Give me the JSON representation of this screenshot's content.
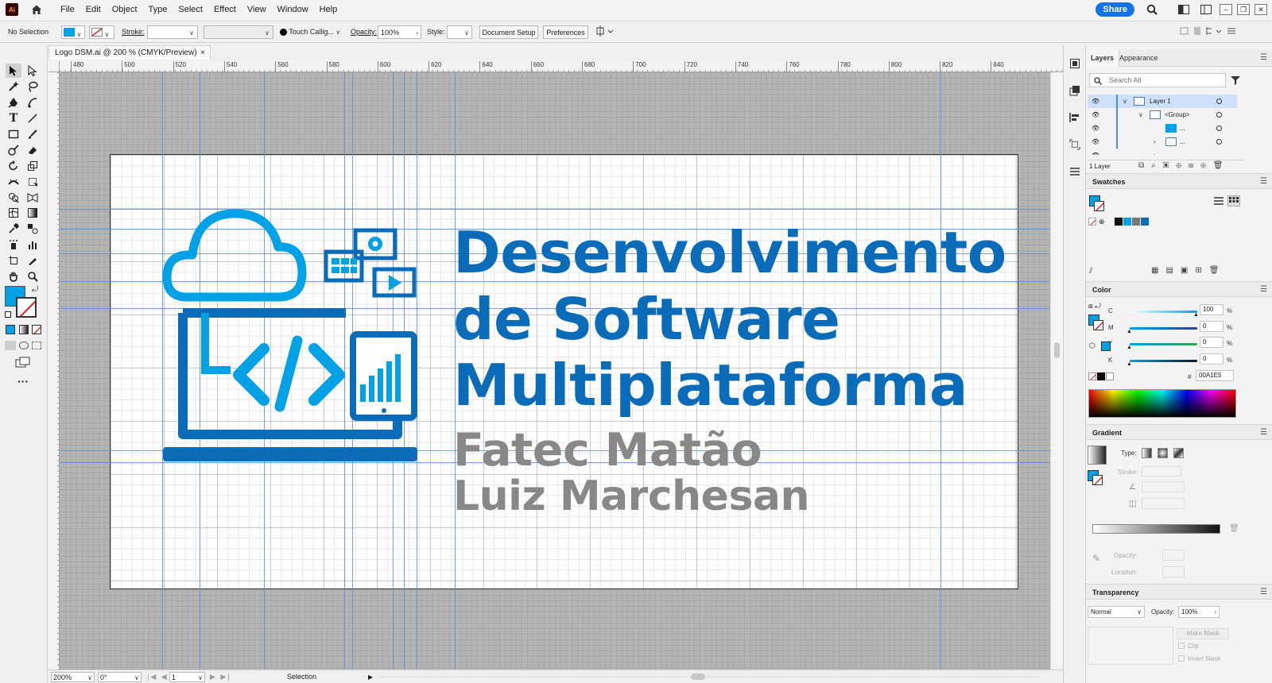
{
  "app": {
    "logo": "Ai",
    "menus": [
      "File",
      "Edit",
      "Object",
      "Type",
      "Select",
      "Effect",
      "View",
      "Window",
      "Help"
    ],
    "share_label": "Share"
  },
  "control_bar": {
    "selection": "No Selection",
    "stroke_label": "Stroke:",
    "brush": "Touch Callig...",
    "opacity_label": "Opacity:",
    "opacity_value": "100%",
    "style_label": "Style:",
    "document_setup": "Document Setup",
    "preferences": "Preferences"
  },
  "doc_tab": {
    "title": "Logo DSM.ai @ 200 % (CMYK/Preview)",
    "close": "×"
  },
  "ruler": {
    "h_ticks": [
      "480",
      "500",
      "520",
      "540",
      "560",
      "580",
      "600",
      "620",
      "640",
      "660",
      "680",
      "700",
      "720",
      "740",
      "760",
      "780",
      "800",
      "820",
      "840"
    ]
  },
  "artwork": {
    "line1": "Desenvolvimento",
    "line2": "de Software",
    "line3": "Multiplataforma",
    "line4": "Fatec Matão",
    "line5": "Luiz Marchesan",
    "blue": "#0a6cb8",
    "light_blue": "#00a1e5",
    "gray": "#888888"
  },
  "status_bar": {
    "zoom": "200%",
    "rotation": "0°",
    "artboard": "1",
    "tool": "Selection"
  },
  "layers_panel": {
    "tabs": [
      "Layers",
      "Appearance"
    ],
    "search_placeholder": "Search All",
    "rows": [
      "Layer 1",
      "<Group>",
      "...",
      "...",
      "..."
    ],
    "footer": "1 Layer"
  },
  "swatches_panel": {
    "title": "Swatches"
  },
  "color_panel": {
    "title": "Color",
    "channels": [
      {
        "label": "C",
        "value": "100",
        "unit": "%"
      },
      {
        "label": "M",
        "value": "0",
        "unit": "%"
      },
      {
        "label": "Y",
        "value": "0",
        "unit": "%"
      },
      {
        "label": "K",
        "value": "0",
        "unit": "%"
      }
    ],
    "hash": "#",
    "hex": "00A1E5"
  },
  "gradient_panel": {
    "title": "Gradient",
    "type_label": "Type:",
    "stroke_label": "Stroke:",
    "opacity_label": "Opacity:",
    "location_label": "Location:"
  },
  "transparency_panel": {
    "title": "Transparency",
    "mode": "Normal",
    "opacity_label": "Opacity:",
    "opacity_value": "100%",
    "make_mask": "Make Mask",
    "clip": "Clip",
    "invert_mask": "Invert Mask"
  }
}
